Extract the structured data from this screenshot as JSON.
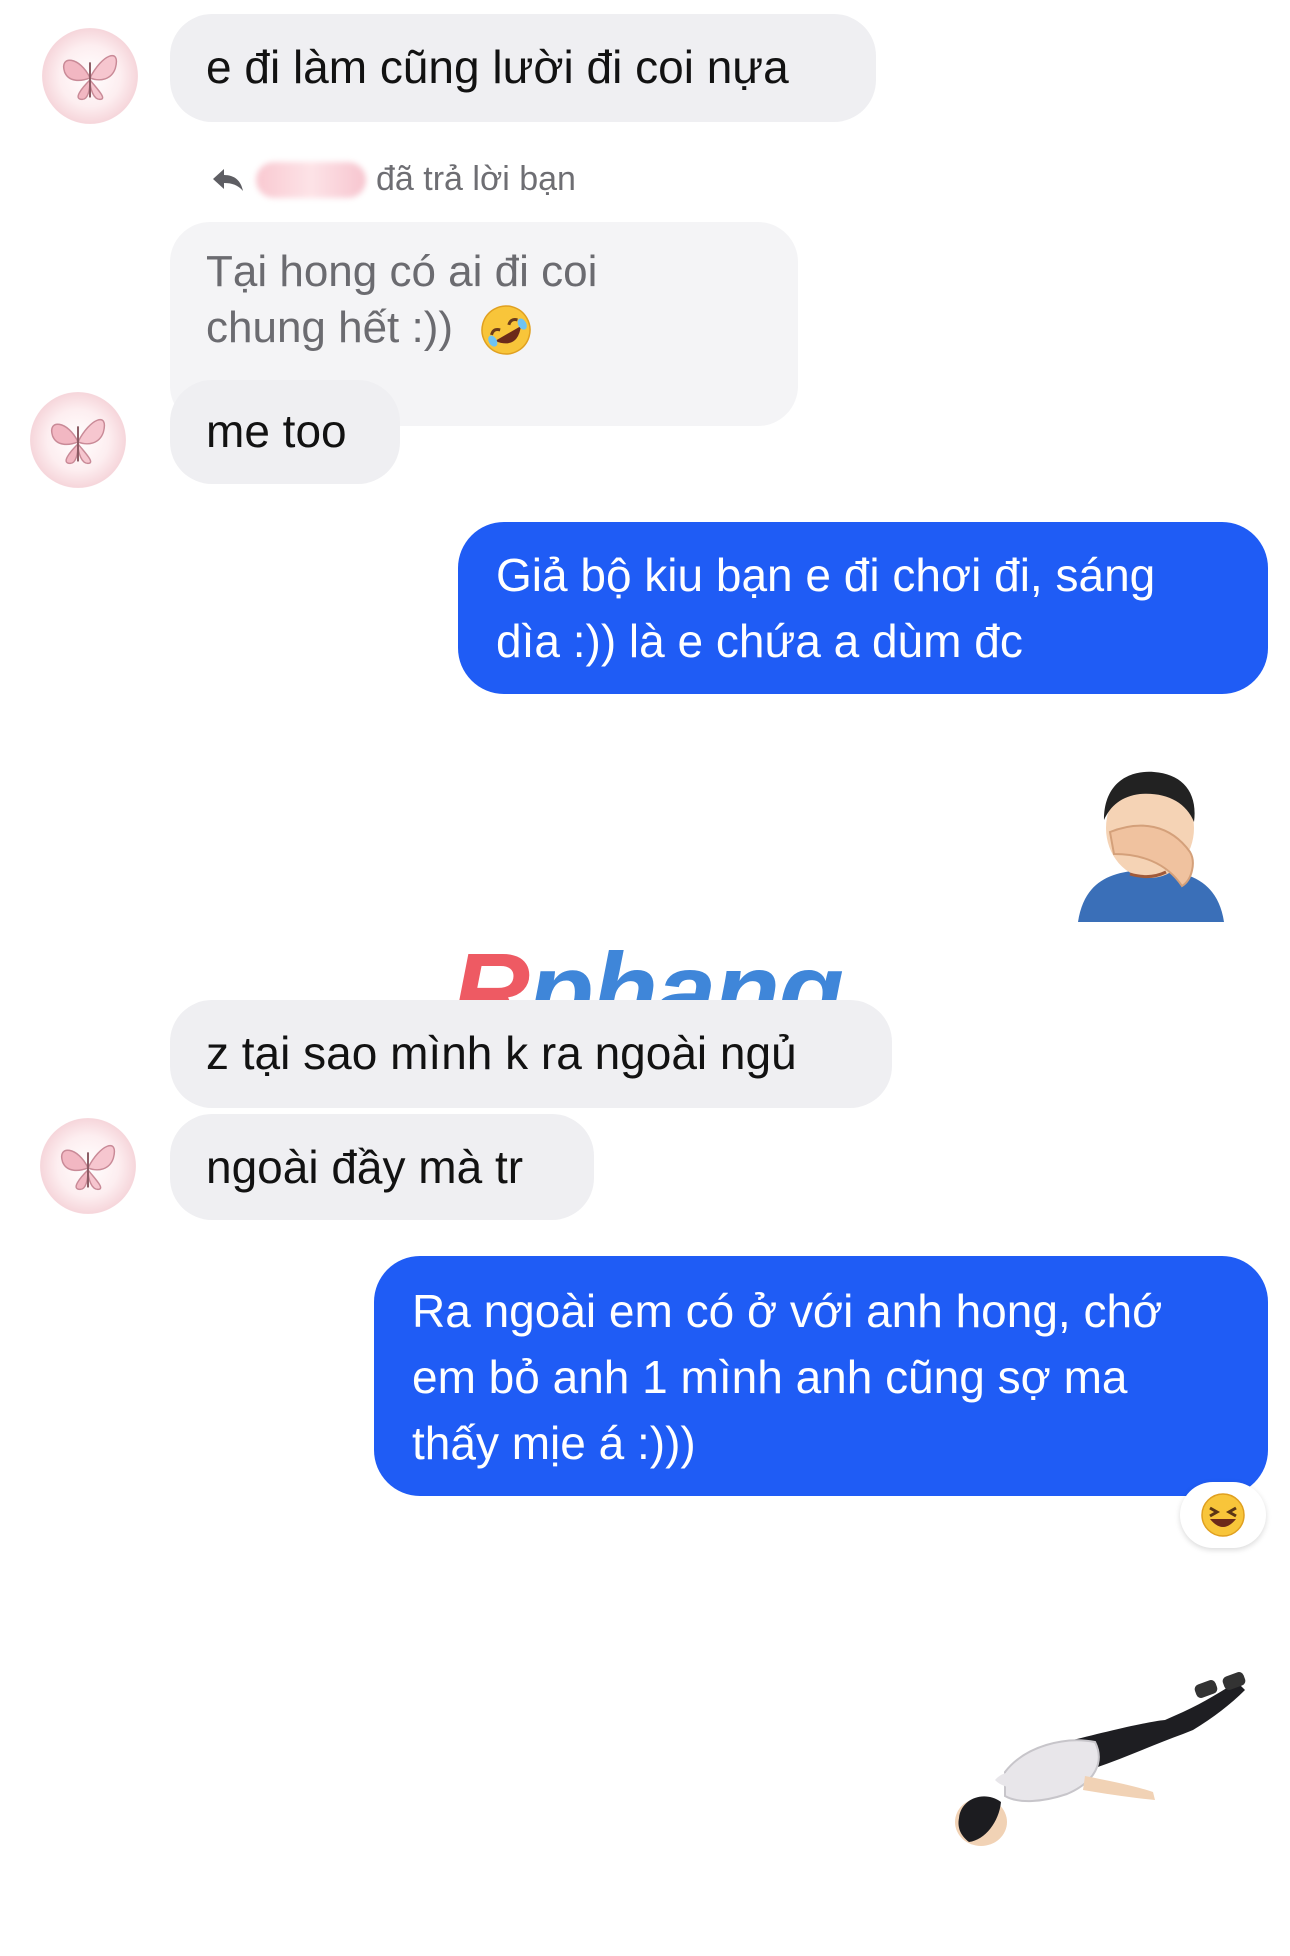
{
  "messages": {
    "m1": "e đi làm cũng lười đi coi nựa",
    "reply_label": "đã trả lời bạn",
    "m2_line1": "Tại hong có ai đi coi",
    "m2_line2": "chung hết :))",
    "m3": "me too",
    "m4_line1": "Giả bộ kiu bạn e đi chơi đi, sáng",
    "m4_line2": "dìa :)) là e chứa a dùm đc",
    "m5": "z tại sao mình k ra ngoài ngủ",
    "m6": "ngoài đầy mà tr",
    "m7_line1": "Ra ngoài em có ở với anh hong, chớ",
    "m7_line2": "em bỏ anh 1 mình anh cũng sợ ma",
    "m7_line3": "thấy mịe á :)))"
  },
  "watermark": {
    "first": "R",
    "rest": "phang"
  },
  "icons": {
    "avatar": "butterfly-icon",
    "reply": "reply-arrow-icon",
    "emoji_rofl": "rofl-emoji-icon",
    "facepalm": "facepalm-sticker-icon",
    "reaction": "laughing-emoji-icon",
    "lying": "lying-man-sticker-icon"
  },
  "colors": {
    "outgoing_bubble": "#1f5cf5",
    "incoming_bubble": "#efeff2"
  }
}
